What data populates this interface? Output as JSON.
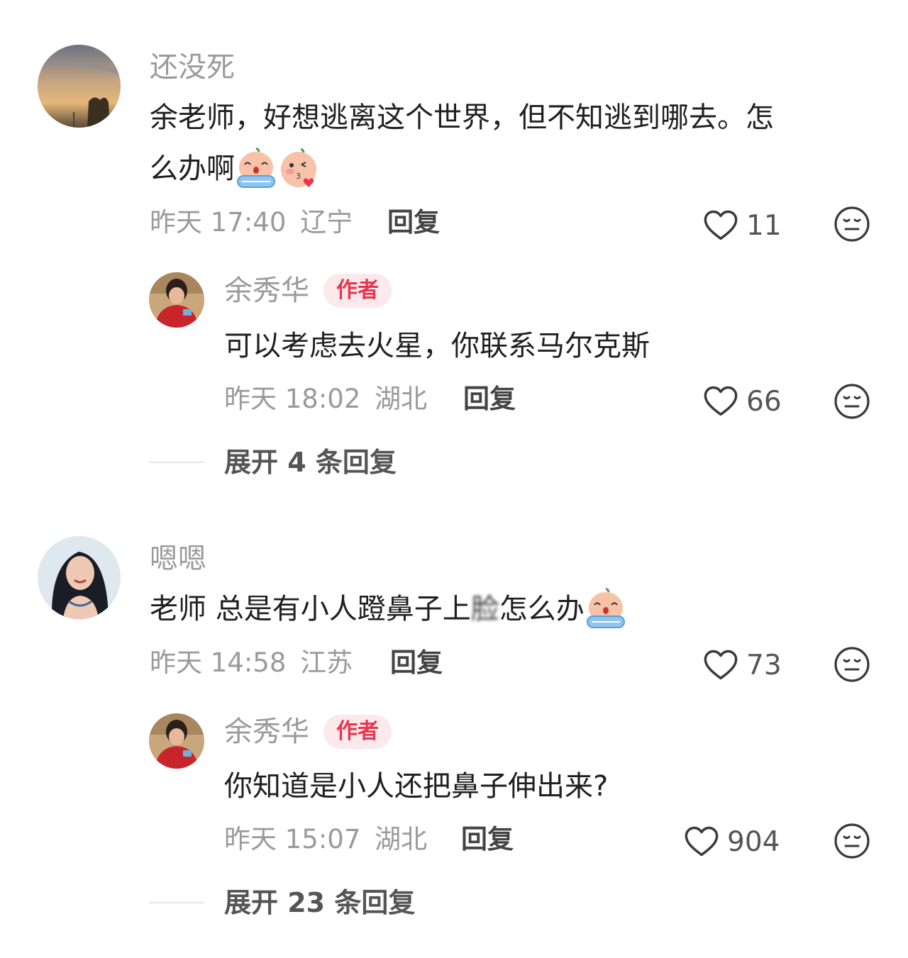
{
  "comments": [
    {
      "user": "还没死",
      "text_line1": "余老师，好想逃离这个世界，但不知逃到哪去。怎",
      "text_line2": "么办啊",
      "emojis": [
        "crying-face-emoji",
        "kiss-face-emoji"
      ],
      "time": "昨天 17:40",
      "location": "辽宁",
      "reply_label": "回复",
      "likes": "11",
      "reply": {
        "user": "余秀华",
        "badge": "作者",
        "text": "可以考虑去火星，你联系马尔克斯",
        "time": "昨天 18:02",
        "location": "湖北",
        "reply_label": "回复",
        "likes": "66"
      },
      "expand_label": "展开 4 条回复"
    },
    {
      "user": "嗯嗯",
      "text_part1": "老师 总是有小人蹬鼻子上",
      "text_part2": "脸",
      "text_part3": "怎么办",
      "emojis": [
        "crying-face-emoji"
      ],
      "time": "昨天 14:58",
      "location": "江苏",
      "reply_label": "回复",
      "likes": "73",
      "reply": {
        "user": "余秀华",
        "badge": "作者",
        "text": "你知道是小人还把鼻子伸出来?",
        "time": "昨天 15:07",
        "location": "湖北",
        "reply_label": "回复",
        "likes": "904"
      },
      "expand_label": "展开 23 条回复"
    }
  ],
  "colors": {
    "badge_bg": "#fbe9eb",
    "badge_text": "#e8364e",
    "meta_text": "#9a9a9a",
    "body_text": "#1f1f1f"
  },
  "icons": [
    "heart-outline-icon",
    "dislike-face-icon"
  ]
}
